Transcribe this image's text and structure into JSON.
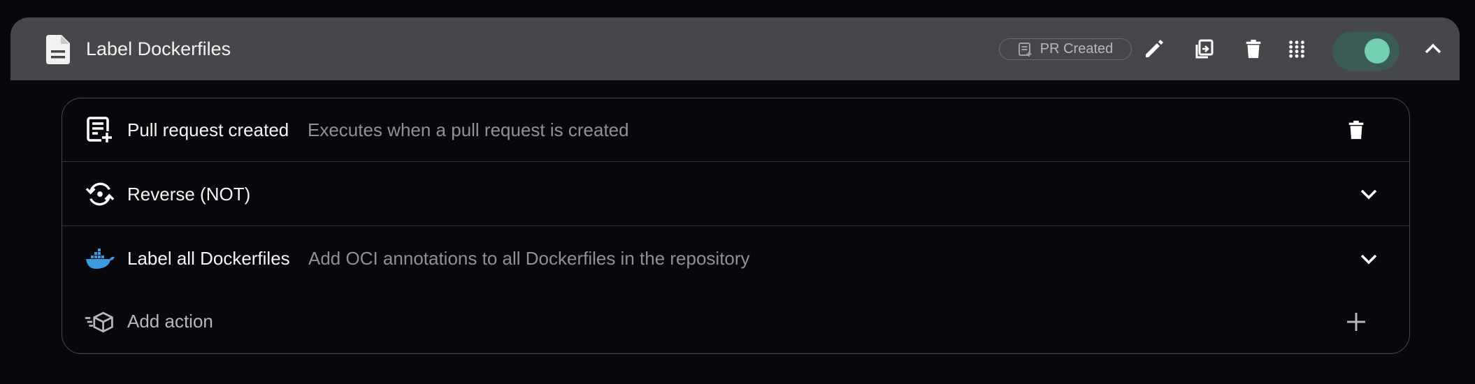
{
  "header": {
    "title": "Label Dockerfiles",
    "badge_label": "PR Created",
    "toggle_state": "on"
  },
  "colors": {
    "background": "#07080b",
    "header_bg": "#45474a",
    "toggle_track": "#3b5c55",
    "toggle_knob": "#73cfb2",
    "docker_blue": "#3a9be0"
  },
  "rows": [
    {
      "title": "Pull request created",
      "description": "Executes when a pull request is created",
      "icon": "pull-request-created-icon",
      "action_icon": "trash-icon"
    },
    {
      "title": "Reverse (NOT)",
      "description": "",
      "icon": "reverse-icon",
      "action_icon": "chevron-down-icon"
    },
    {
      "title": "Label all Dockerfiles",
      "description": "Add OCI annotations to all Dockerfiles in the repository",
      "icon": "docker-icon",
      "action_icon": "chevron-down-icon"
    },
    {
      "title": "Add action",
      "description": "",
      "icon": "add-action-icon",
      "action_icon": "plus-icon"
    }
  ]
}
